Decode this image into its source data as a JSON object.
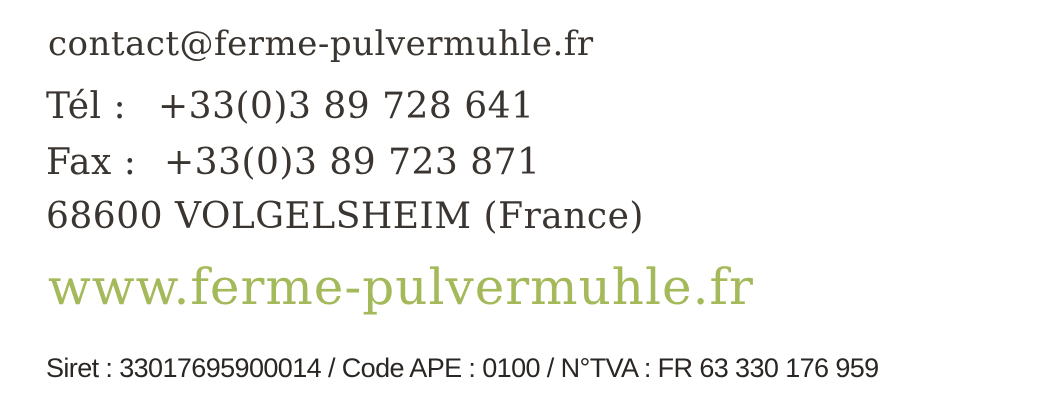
{
  "contact": {
    "email": "contact@ferme-pulvermuhle.fr",
    "phone_label": "Tél :",
    "phone": "+33(0)3 89 728 641",
    "fax_label": "Fax :",
    "fax": "+33(0)3 89 723 871",
    "address": "68600 VOLGELSHEIM (France)",
    "website": "www.ferme-pulvermuhle.fr",
    "legal": "Siret : 33017695900014 / Code APE : 0100 / N°TVA : FR 63 330 176 959"
  },
  "colors": {
    "text": "#3a3530",
    "website": "#a3b95a",
    "legal": "#2a2623",
    "background": "#ffffff"
  }
}
